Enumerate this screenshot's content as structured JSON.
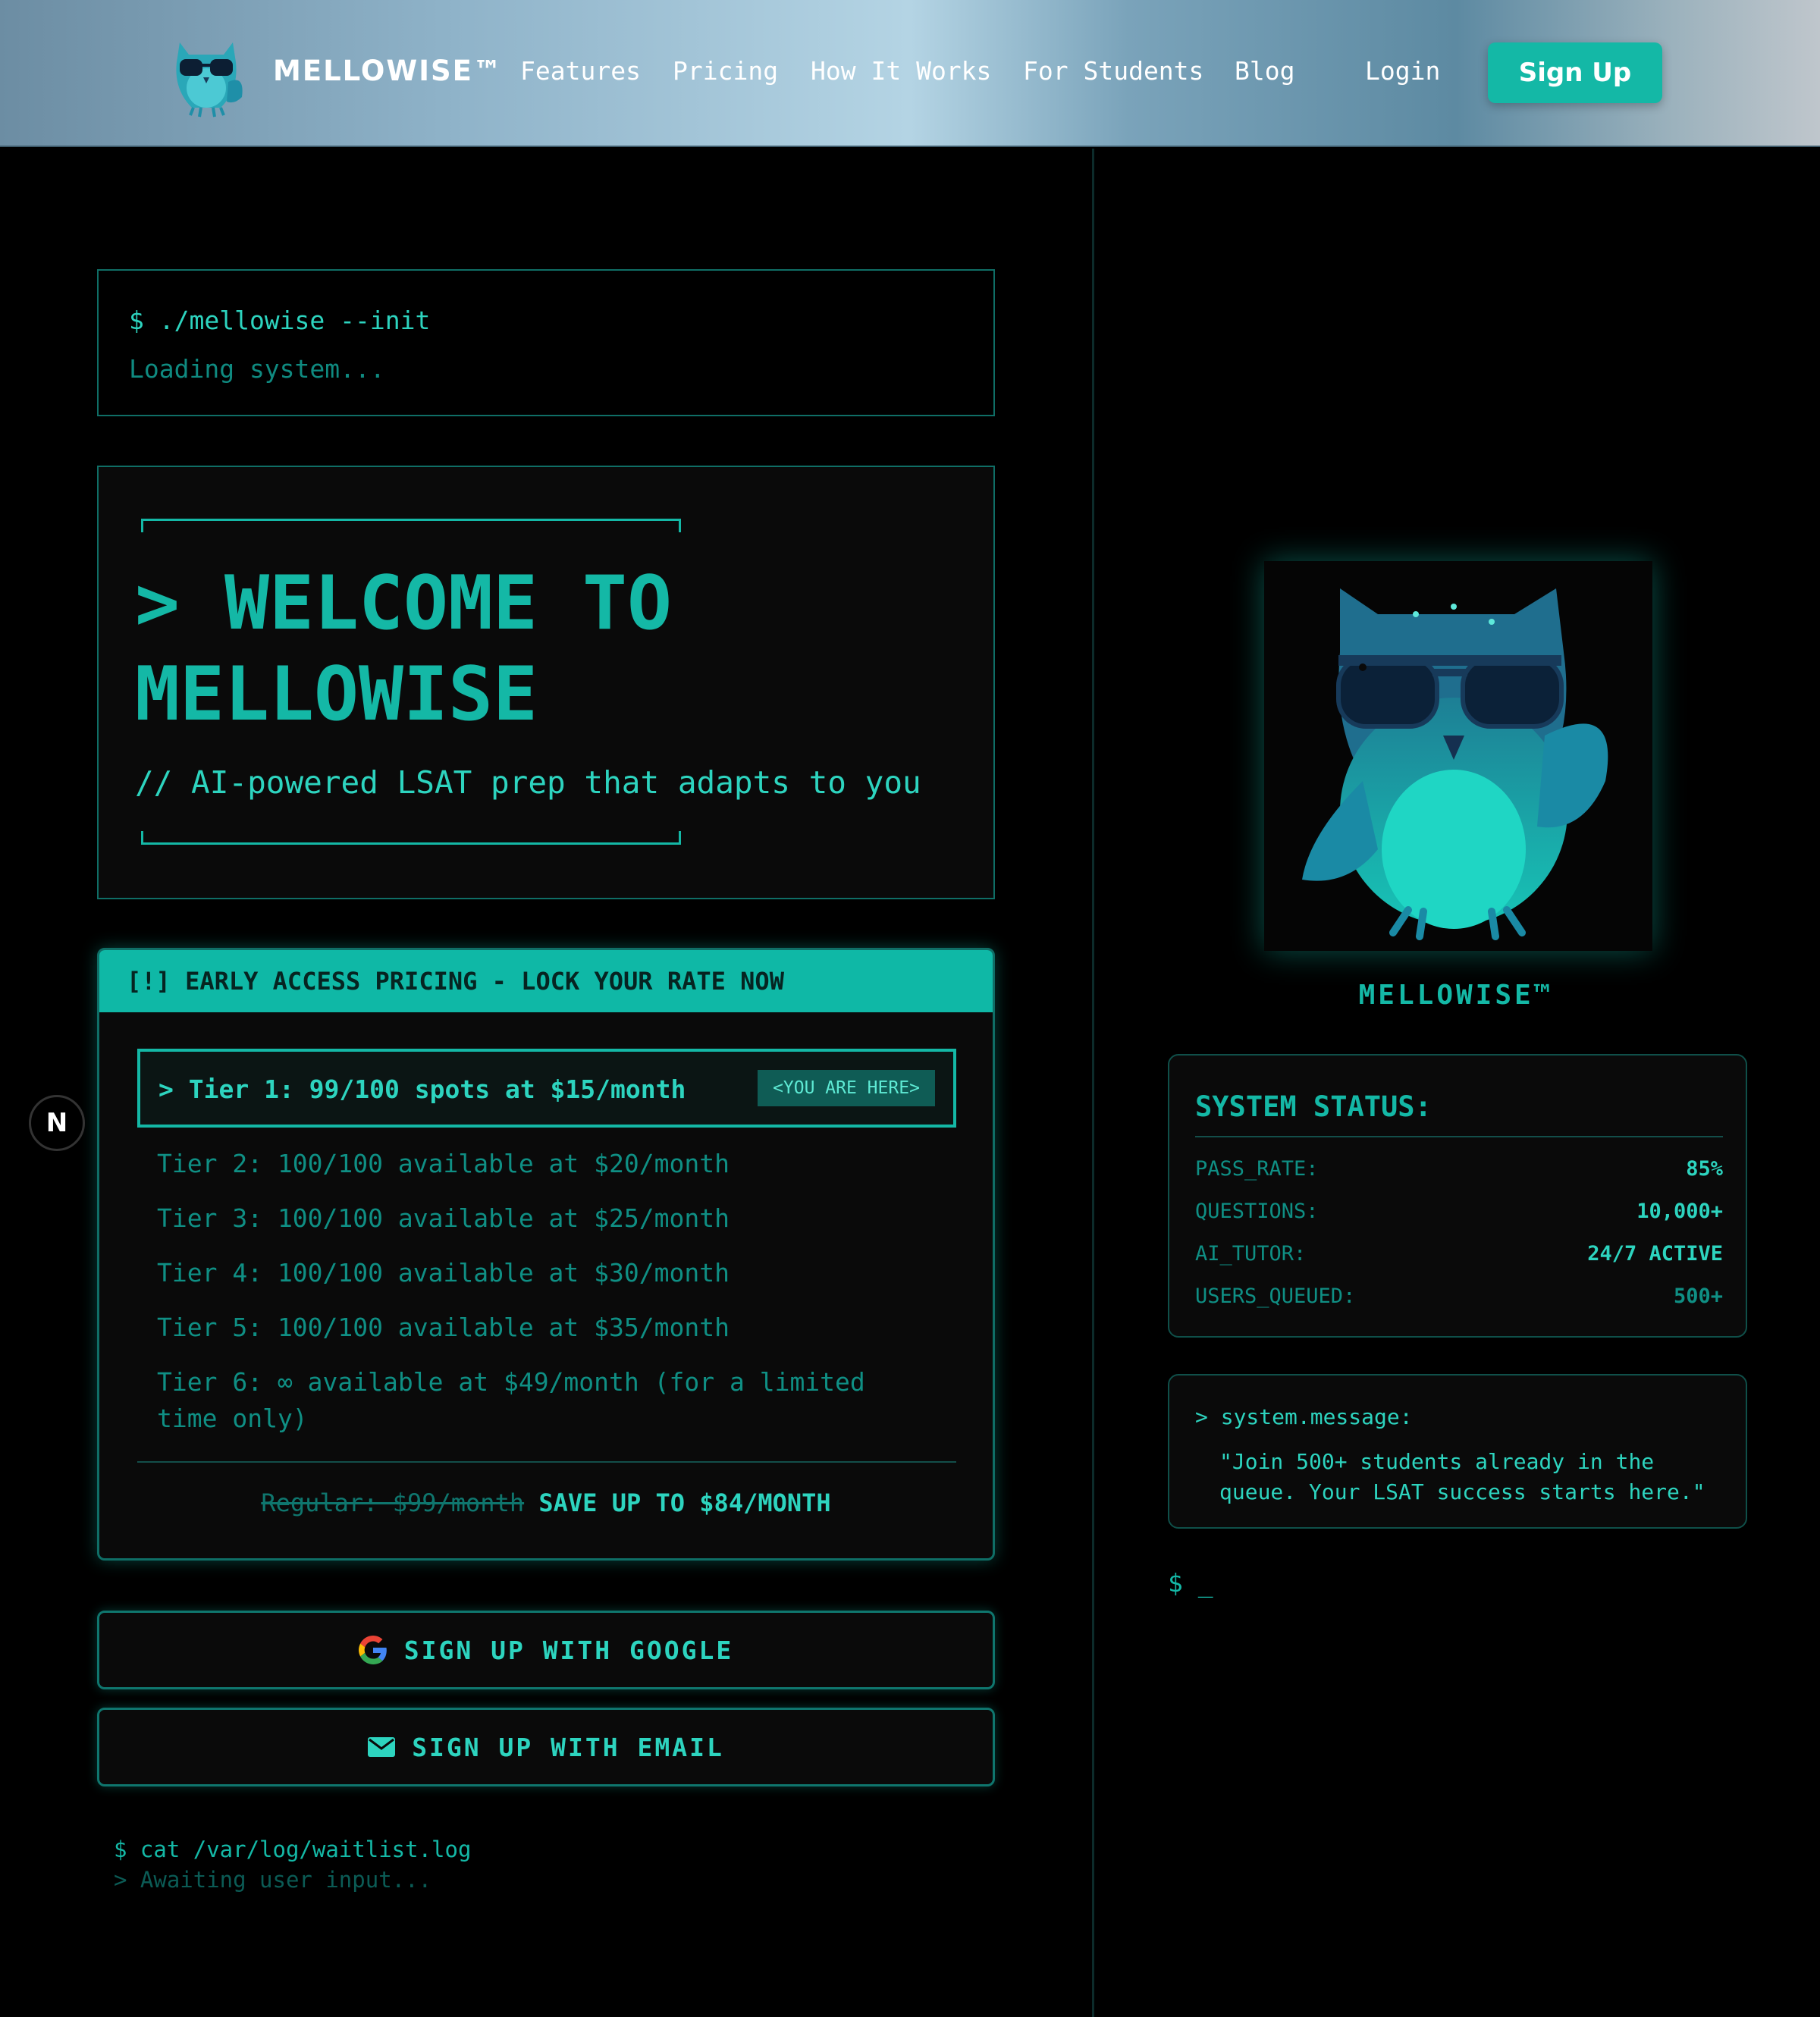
{
  "nav": {
    "brand": "MELLOWISE™",
    "links": [
      "Features",
      "Pricing",
      "How It Works",
      "For Students",
      "Blog"
    ],
    "login": "Login",
    "signup": "Sign Up"
  },
  "terminal": {
    "command": "$ ./mellowise --init",
    "status": "Loading system..."
  },
  "hero": {
    "title": "> WELCOME TO MELLOWISE",
    "subtitle": "// AI-powered LSAT prep that adapts to you"
  },
  "pricing": {
    "header": "[!] EARLY ACCESS PRICING - LOCK YOUR RATE NOW",
    "current_tier": {
      "label": "> Tier 1: 99/100 spots at $15/month",
      "badge": "<YOU ARE HERE>"
    },
    "tiers": [
      "Tier 2: 100/100 available at $20/month",
      "Tier 3: 100/100 available at $25/month",
      "Tier 4: 100/100 available at $30/month",
      "Tier 5: 100/100 available at $35/month",
      "Tier 6: ∞ available at $49/month (for a limited time only)"
    ],
    "regular": "Regular: $99/month",
    "save": "SAVE UP TO $84/MONTH"
  },
  "buttons": {
    "google": "SIGN UP WITH GOOGLE",
    "email": "SIGN UP WITH EMAIL"
  },
  "log": {
    "command": "$ cat /var/log/waitlist.log",
    "awaiting": "> Awaiting user input..."
  },
  "dev_badge": "N",
  "sidebar": {
    "caption": "MELLOWISE™",
    "status": {
      "title": "SYSTEM STATUS:",
      "rows": [
        {
          "key": "PASS_RATE:",
          "value": "85%"
        },
        {
          "key": "QUESTIONS:",
          "value": "10,000+"
        },
        {
          "key": "AI_TUTOR:",
          "value": "24/7 ACTIVE"
        },
        {
          "key": "USERS_QUEUED:",
          "value": "500+"
        }
      ]
    },
    "message": {
      "head": "> system.message:",
      "body": "\"Join 500+ students already in the queue. Your LSAT success starts here.\""
    },
    "prompt": "$ _"
  },
  "colors": {
    "accent": "#14b8a6",
    "accent_light": "#2dd4bf",
    "background": "#000000",
    "header_bar": "#0fb8a6"
  },
  "icons": [
    "owl-logo-icon",
    "google-icon",
    "mail-icon",
    "owl-mascot-image"
  ]
}
